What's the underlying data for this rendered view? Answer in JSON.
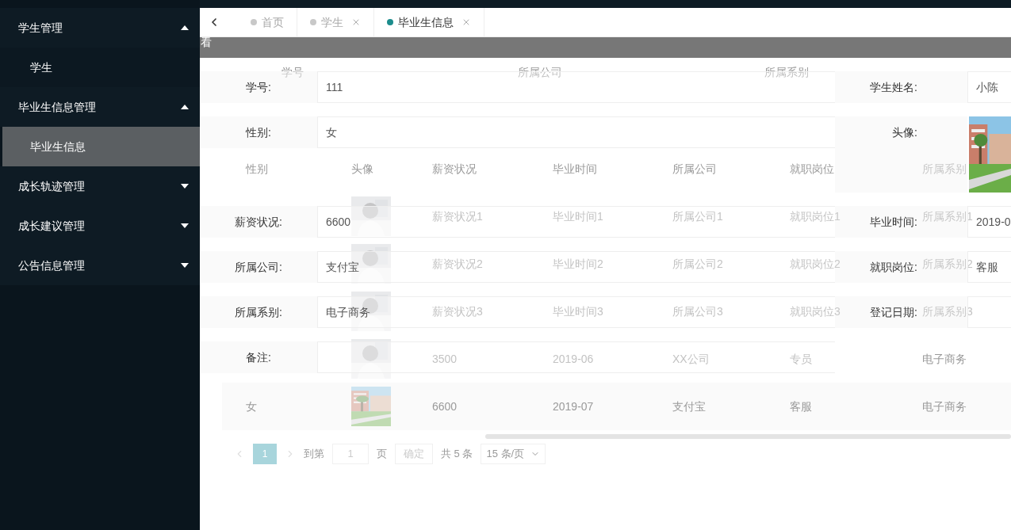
{
  "sidebar": {
    "items": [
      {
        "label": "学生管理",
        "expanded": true,
        "children": [
          {
            "label": "学生",
            "selected": false
          }
        ]
      },
      {
        "label": "毕业生信息管理",
        "expanded": true,
        "children": [
          {
            "label": "毕业生信息",
            "selected": true
          }
        ]
      },
      {
        "label": "成长轨迹管理",
        "expanded": false
      },
      {
        "label": "成长建议管理",
        "expanded": false
      },
      {
        "label": "公告信息管理",
        "expanded": false
      }
    ]
  },
  "tabs": [
    {
      "label": "首页",
      "selected": false,
      "closable": false
    },
    {
      "label": "学生",
      "selected": false,
      "closable": true
    },
    {
      "label": "毕业生信息",
      "selected": true,
      "closable": true
    }
  ],
  "search": {
    "labels": [
      "学号",
      "所属公司",
      "所属系别"
    ]
  },
  "table": {
    "columns": [
      "性别",
      "头像",
      "薪资状况",
      "毕业时间",
      "所属公司",
      "就职岗位",
      "所属系别"
    ],
    "rows": [
      {
        "salary": "薪资状况1",
        "grad_time": "毕业时间1",
        "company": "所属公司1",
        "position": "就职岗位1",
        "department": "所属系别1"
      },
      {
        "salary": "薪资状况2",
        "grad_time": "毕业时间2",
        "company": "所属公司2",
        "position": "就职岗位2",
        "department": "所属系别2"
      },
      {
        "salary": "薪资状况3",
        "grad_time": "毕业时间3",
        "company": "所属公司3",
        "position": "就职岗位3",
        "department": "所属系别3"
      },
      {
        "salary": "3500",
        "grad_time": "2019-06",
        "company": "XX公司",
        "position": "专员",
        "department": "电子商务"
      },
      {
        "gender": "女",
        "salary": "6600",
        "grad_time": "2019-07",
        "company": "支付宝",
        "position": "客服",
        "department": "电子商务"
      }
    ]
  },
  "pagination": {
    "pages": [
      {
        "label": "1",
        "selected": true
      }
    ],
    "goto_prefix": "到第",
    "goto_value": "1",
    "goto_suffix": "页",
    "confirm": "确定",
    "total": "共 5 条",
    "page_size": "15 条/页"
  },
  "dialog": {
    "title": "看",
    "rows": [
      [
        {
          "kind": "text",
          "label": "学号:",
          "value": "111"
        },
        {
          "kind": "text",
          "label": "学生姓名:",
          "value": "小陈"
        }
      ],
      [
        {
          "kind": "text",
          "label": "性别:",
          "value": "女"
        },
        {
          "kind": "picture",
          "label": "头像:"
        }
      ],
      [
        {
          "kind": "text",
          "label": "薪资状况:",
          "value": "6600"
        },
        {
          "kind": "text",
          "label": "毕业时间:",
          "value": "2019-0"
        }
      ],
      [
        {
          "kind": "text",
          "label": "所属公司:",
          "value": "支付宝"
        },
        {
          "kind": "text",
          "label": "就职岗位:",
          "value": "客服"
        }
      ],
      [
        {
          "kind": "text",
          "label": "所属系别:",
          "value": "电子商务"
        },
        {
          "kind": "text",
          "label": "登记日期:"
        }
      ],
      [
        {
          "kind": "text",
          "label": "备注:"
        }
      ]
    ]
  }
}
